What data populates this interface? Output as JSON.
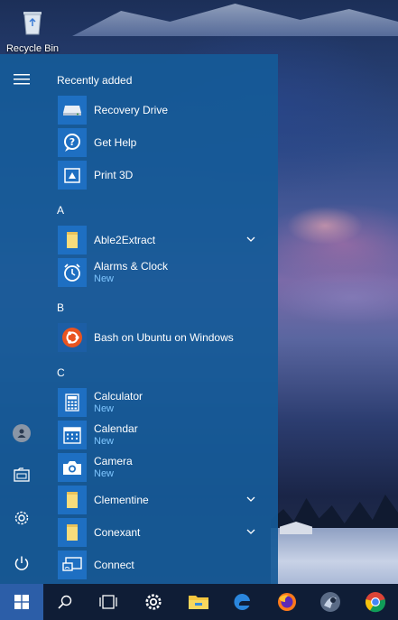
{
  "desktop": {
    "recycle_bin_label": "Recycle Bin"
  },
  "start_menu": {
    "sections": {
      "recently_added": "Recently added",
      "a": "A",
      "b": "B",
      "c": "C"
    },
    "apps": [
      {
        "name": "Recovery Drive",
        "icon": "recovery-drive-icon"
      },
      {
        "name": "Get Help",
        "icon": "get-help-icon"
      },
      {
        "name": "Print 3D",
        "icon": "print-3d-icon"
      },
      {
        "name": "Able2Extract",
        "icon": "folder-icon",
        "expandable": true
      },
      {
        "name": "Alarms & Clock",
        "badge": "New",
        "icon": "alarm-clock-icon"
      },
      {
        "name": "Bash on Ubuntu on Windows",
        "icon": "ubuntu-icon"
      },
      {
        "name": "Calculator",
        "badge": "New",
        "icon": "calculator-icon"
      },
      {
        "name": "Calendar",
        "badge": "New",
        "icon": "calendar-icon"
      },
      {
        "name": "Camera",
        "badge": "New",
        "icon": "camera-icon"
      },
      {
        "name": "Clementine",
        "icon": "folder-icon",
        "expandable": true
      },
      {
        "name": "Conexant",
        "icon": "folder-icon",
        "expandable": true
      },
      {
        "name": "Connect",
        "icon": "connect-icon"
      }
    ],
    "rail_icons": [
      "hamburger-menu-icon",
      "user-avatar-icon",
      "documents-icon",
      "settings-gear-icon",
      "power-icon"
    ]
  },
  "taskbar": {
    "items": [
      "windows-start-icon",
      "search-icon",
      "task-view-icon",
      "settings-icon",
      "file-explorer-icon",
      "edge-icon",
      "firefox-icon",
      "app-icon",
      "chrome-icon"
    ]
  },
  "colors": {
    "start_bg": "#165a98",
    "tile_bg": "#1e6fc2",
    "new_badge": "#7fc6ff",
    "taskbar_bg": "#0f1d36"
  }
}
